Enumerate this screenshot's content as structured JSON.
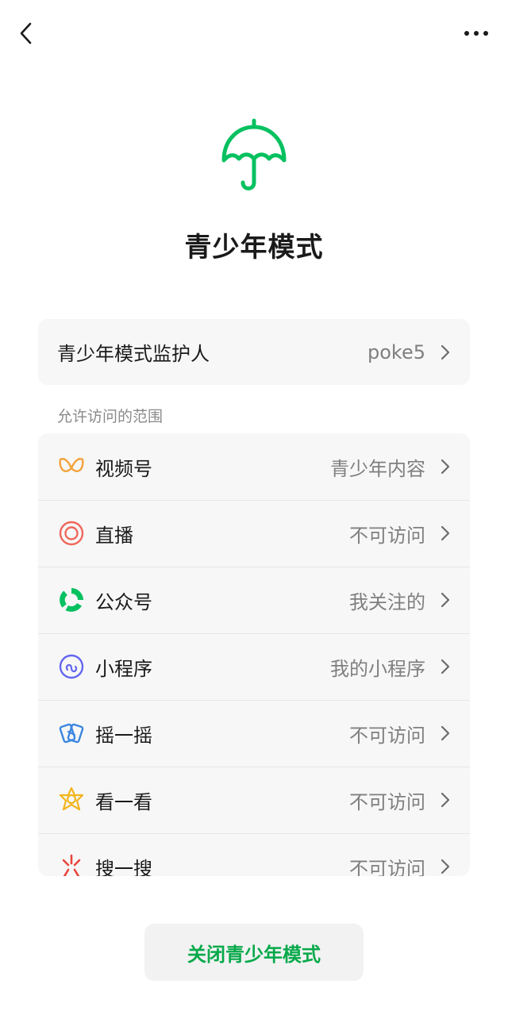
{
  "nav": {
    "back_icon": "chevron-left-icon",
    "more_icon": "more-dots-icon"
  },
  "hero": {
    "icon": "umbrella-icon",
    "accent": "#07c160",
    "title": "青少年模式"
  },
  "guardian": {
    "label": "青少年模式监护人",
    "value": "poke5"
  },
  "scope_label": "允许访问的范围",
  "scope_items": [
    {
      "icon": "channels-icon",
      "label": "视频号",
      "value": "青少年内容"
    },
    {
      "icon": "live-icon",
      "label": "直播",
      "value": "不可访问"
    },
    {
      "icon": "official-accounts-icon",
      "label": "公众号",
      "value": "我关注的"
    },
    {
      "icon": "mini-program-icon",
      "label": "小程序",
      "value": "我的小程序"
    },
    {
      "icon": "shake-icon",
      "label": "摇一摇",
      "value": "不可访问"
    },
    {
      "icon": "top-stories-icon",
      "label": "看一看",
      "value": "不可访问"
    },
    {
      "icon": "search-icon",
      "label": "搜一搜",
      "value": "不可访问"
    }
  ],
  "close_button": "关闭青少年模式"
}
